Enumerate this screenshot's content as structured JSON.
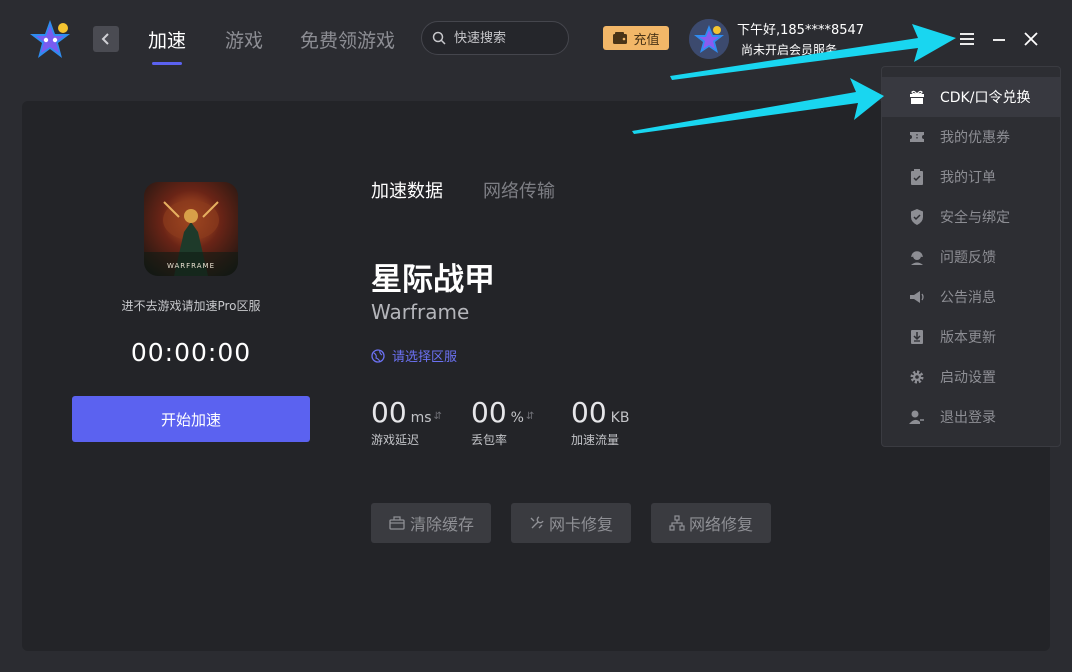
{
  "header": {
    "nav_tabs": [
      "加速",
      "游戏",
      "免费领游戏"
    ],
    "search_placeholder": "快速搜索",
    "recharge_label": "充值",
    "greeting": "下午好,185****8547",
    "vip_status": "尚未开启会员服务"
  },
  "game": {
    "cover_caption": "WARFRAME",
    "hint": "进不去游戏请加速Pro区服",
    "timer": "00:00:00",
    "start_label": "开始加速",
    "tabs": [
      "加速数据",
      "网络传输"
    ],
    "name_cn": "星际战甲",
    "name_en": "Warframe",
    "region_prompt": "请选择区服"
  },
  "stats": [
    {
      "value": "00",
      "unit": "ms",
      "label": "游戏延迟"
    },
    {
      "value": "00",
      "unit": "%",
      "label": "丢包率"
    },
    {
      "value": "00",
      "unit": "KB",
      "label": "加速流量"
    }
  ],
  "tools": [
    "清除缓存",
    "网卡修复",
    "网络修复"
  ],
  "menu": {
    "items": [
      {
        "label": "CDK/口令兑换",
        "icon": "gift-icon"
      },
      {
        "label": "我的优惠券",
        "icon": "coupon-icon"
      },
      {
        "label": "我的订单",
        "icon": "order-clipboard-icon"
      },
      {
        "label": "安全与绑定",
        "icon": "shield-check-icon"
      },
      {
        "label": "问题反馈",
        "icon": "feedback-headset-icon"
      },
      {
        "label": "公告消息",
        "icon": "speaker-icon"
      },
      {
        "label": "版本更新",
        "icon": "update-icon"
      },
      {
        "label": "启动设置",
        "icon": "gear-icon"
      },
      {
        "label": "退出登录",
        "icon": "logout-user-icon"
      }
    ]
  },
  "colors": {
    "accent": "#5b62f0",
    "recharge": "#f2b768",
    "annotation_arrow": "#19d6f0",
    "background": "#2b2c31",
    "panel": "#232428"
  }
}
